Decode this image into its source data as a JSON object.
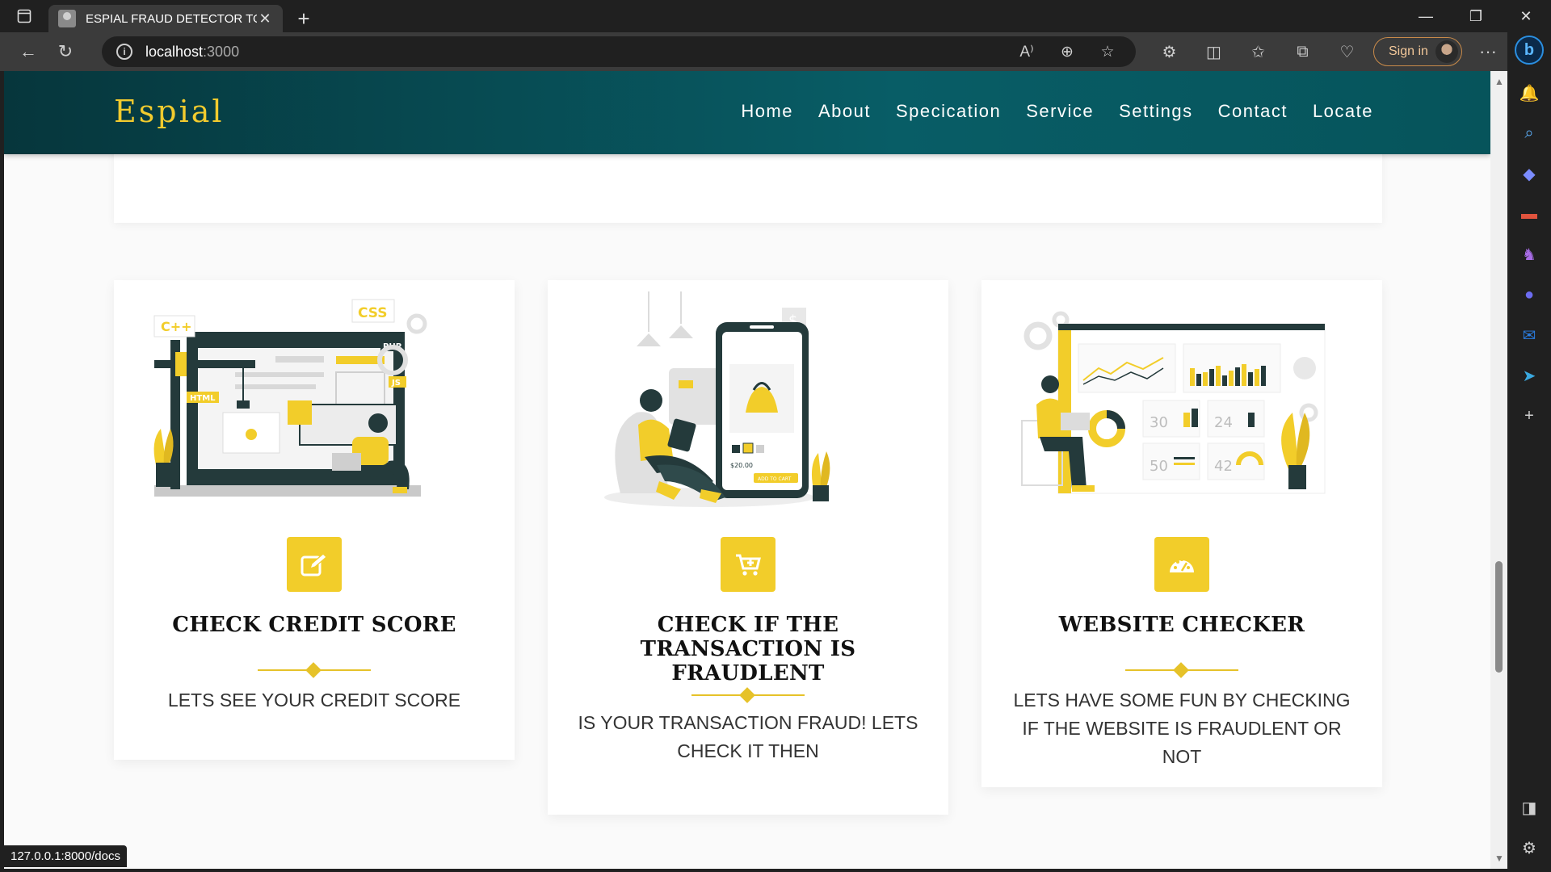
{
  "browser": {
    "tab_title": "ESPIAL FRAUD DETECTOR TOOL",
    "url_host": "localhost",
    "url_port": ":3000",
    "sign_in_label": "Sign in",
    "status_url": "127.0.0.1:8000/docs"
  },
  "site": {
    "brand": "Espial",
    "nav": [
      "Home",
      "About",
      "Specication",
      "Service",
      "Settings",
      "Contact",
      "Locate"
    ]
  },
  "cards": [
    {
      "title": "CHECK CREDIT SCORE",
      "description": "LETS SEE YOUR CREDIT SCORE",
      "icon": "edit-icon"
    },
    {
      "title": "CHECK IF THE TRANSACTION IS FRAUDLENT",
      "description": "IS YOUR TRANSACTION FRAUD! LETS CHECK IT THEN",
      "icon": "cart-plus-icon"
    },
    {
      "title": "WEBSITE CHECKER",
      "description": "LETS HAVE SOME FUN BY CHECKING IF THE WEBSITE IS FRAUDLENT OR NOT",
      "icon": "dashboard-icon"
    }
  ],
  "illustrations": {
    "code_tags": [
      "C++",
      "CSS",
      "PHP",
      "HTML",
      "JS"
    ],
    "phone_price": "$20.00",
    "phone_button": "ADD TO CART",
    "dash_numbers": [
      "30",
      "24",
      "50",
      "42"
    ]
  },
  "colors": {
    "accent": "#f2cd2a",
    "header_dark": "#06363c",
    "header_teal": "#085d66"
  }
}
